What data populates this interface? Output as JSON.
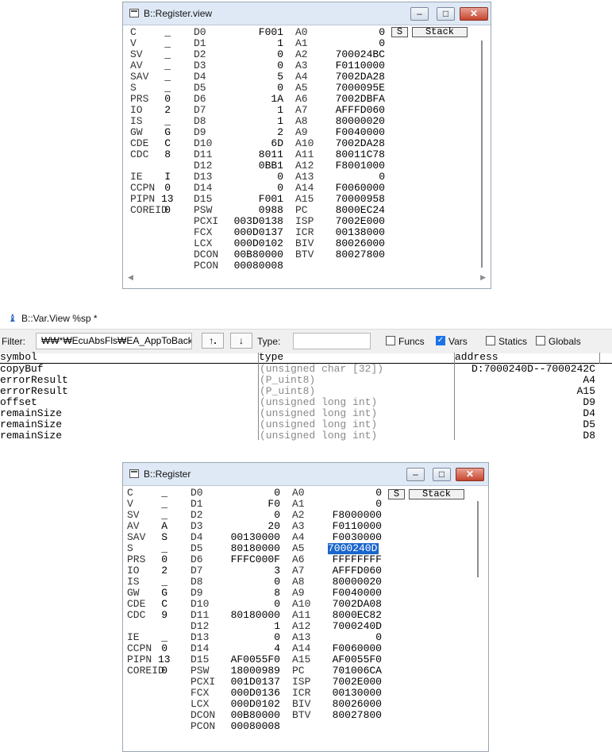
{
  "win1": {
    "title": "B::Register.view",
    "buttons": {
      "minimize": "–",
      "maximize": "□",
      "close": "✕",
      "s": "S",
      "stack": "Stack"
    },
    "flags": [
      [
        "C",
        "_"
      ],
      [
        "V",
        "_"
      ],
      [
        "SV",
        "_"
      ],
      [
        "AV",
        "_"
      ],
      [
        "SAV",
        "_"
      ],
      [
        "S",
        "_"
      ],
      [
        "PRS",
        "0"
      ],
      [
        "IO",
        "2"
      ],
      [
        "IS",
        "_"
      ],
      [
        "GW",
        "G"
      ],
      [
        "CDE",
        "C"
      ],
      [
        "CDC",
        "8"
      ],
      [
        "",
        ""
      ],
      [
        "IE",
        "I"
      ],
      [
        "CCPN",
        "0"
      ],
      [
        "PIPN",
        "13"
      ],
      [
        "COREID",
        "0"
      ]
    ],
    "d": [
      [
        "D0",
        "F001"
      ],
      [
        "D1",
        "1"
      ],
      [
        "D2",
        "0"
      ],
      [
        "D3",
        "0"
      ],
      [
        "D4",
        "5"
      ],
      [
        "D5",
        "0"
      ],
      [
        "D6",
        "1A"
      ],
      [
        "D7",
        "1"
      ],
      [
        "D8",
        "1"
      ],
      [
        "D9",
        "2"
      ],
      [
        "D10",
        "6D"
      ],
      [
        "D11",
        "8011"
      ],
      [
        "D12",
        "0BB1"
      ],
      [
        "D13",
        "0"
      ],
      [
        "D14",
        "0"
      ],
      [
        "D15",
        "F001"
      ],
      [
        "PSW",
        "0988"
      ],
      [
        "PCXI",
        "003D0138"
      ],
      [
        "FCX",
        "000D0137"
      ],
      [
        "LCX",
        "000D0102"
      ],
      [
        "DCON",
        "00B80000"
      ],
      [
        "PCON",
        "00080008"
      ]
    ],
    "a": [
      [
        "A0",
        "0"
      ],
      [
        "A1",
        "0"
      ],
      [
        "A2",
        "700024BC"
      ],
      [
        "A3",
        "F0110000"
      ],
      [
        "A4",
        "7002DA28"
      ],
      [
        "A5",
        "7000095E"
      ],
      [
        "A6",
        "7002DBFA"
      ],
      [
        "A7",
        "AFFFD060"
      ],
      [
        "A8",
        "80000020"
      ],
      [
        "A9",
        "F0040000"
      ],
      [
        "A10",
        "7002DA28"
      ],
      [
        "A11",
        "80011C78"
      ],
      [
        "A12",
        "F8001000"
      ],
      [
        "A13",
        "0"
      ],
      [
        "A14",
        "F0060000"
      ],
      [
        "A15",
        "70000958"
      ],
      [
        "PC",
        "8000EC24"
      ],
      [
        "ISP",
        "7002E000"
      ],
      [
        "ICR",
        "00138000"
      ],
      [
        "BIV",
        "80026000"
      ],
      [
        "BTV",
        "80027800"
      ]
    ]
  },
  "varview": {
    "title": "B::Var.View %sp *",
    "filter_label": "Filter:",
    "filter_value": "₩₩*₩EcuAbsFls₩EA_AppToBackup",
    "up_button": "↑.",
    "down_button": "↓",
    "type_label": "Type:",
    "type_value": "",
    "checks": [
      {
        "label": "Funcs",
        "checked": false
      },
      {
        "label": "Vars",
        "checked": true
      },
      {
        "label": "Statics",
        "checked": false
      },
      {
        "label": "Globals",
        "checked": false
      }
    ],
    "columns": [
      "symbol",
      "type",
      "address"
    ],
    "rows": [
      [
        "copyBuf",
        "(unsigned char [32])",
        "D:7000240D--7000242C"
      ],
      [
        "errorResult",
        "(P_uint8)",
        "A4"
      ],
      [
        "errorResult",
        "(P_uint8)",
        "A15"
      ],
      [
        "offset",
        "(unsigned long int)",
        "D9"
      ],
      [
        "remainSize",
        "(unsigned long int)",
        "D4"
      ],
      [
        "remainSize",
        "(unsigned long int)",
        "D5"
      ],
      [
        "remainSize",
        "(unsigned long int)",
        "D8"
      ]
    ]
  },
  "win2": {
    "title": "B::Register",
    "buttons": {
      "minimize": "–",
      "maximize": "□",
      "close": "✕",
      "s": "S",
      "stack": "Stack"
    },
    "flags": [
      [
        "C",
        "_"
      ],
      [
        "V",
        "_"
      ],
      [
        "SV",
        "_"
      ],
      [
        "AV",
        "A"
      ],
      [
        "SAV",
        "S"
      ],
      [
        "S",
        "_"
      ],
      [
        "PRS",
        "0"
      ],
      [
        "IO",
        "2"
      ],
      [
        "IS",
        "_"
      ],
      [
        "GW",
        "G"
      ],
      [
        "CDE",
        "C"
      ],
      [
        "CDC",
        "9"
      ],
      [
        "",
        ""
      ],
      [
        "IE",
        "_"
      ],
      [
        "CCPN",
        "0"
      ],
      [
        "PIPN",
        "13"
      ],
      [
        "COREID",
        "0"
      ]
    ],
    "d": [
      [
        "D0",
        "0"
      ],
      [
        "D1",
        "F0"
      ],
      [
        "D2",
        "0"
      ],
      [
        "D3",
        "20"
      ],
      [
        "D4",
        "00130000"
      ],
      [
        "D5",
        "80180000"
      ],
      [
        "D6",
        "FFFC000F"
      ],
      [
        "D7",
        "3"
      ],
      [
        "D8",
        "0"
      ],
      [
        "D9",
        "8"
      ],
      [
        "D10",
        "0"
      ],
      [
        "D11",
        "80180000"
      ],
      [
        "D12",
        "1"
      ],
      [
        "D13",
        "0"
      ],
      [
        "D14",
        "4"
      ],
      [
        "D15",
        "AF0055F0"
      ],
      [
        "PSW",
        "18000989"
      ],
      [
        "PCXI",
        "001D0137"
      ],
      [
        "FCX",
        "000D0136"
      ],
      [
        "LCX",
        "000D0102"
      ],
      [
        "DCON",
        "00B80000"
      ],
      [
        "PCON",
        "00080008"
      ]
    ],
    "a": [
      [
        "A0",
        "0"
      ],
      [
        "A1",
        "0"
      ],
      [
        "A2",
        "F8000000"
      ],
      [
        "A3",
        "F0110000"
      ],
      [
        "A4",
        "F0030000"
      ],
      [
        "A5",
        "7000240D"
      ],
      [
        "A6",
        "FFFFFFFF"
      ],
      [
        "A7",
        "AFFFD060"
      ],
      [
        "A8",
        "80000020"
      ],
      [
        "A9",
        "F0040000"
      ],
      [
        "A10",
        "7002DA08"
      ],
      [
        "A11",
        "8000EC82"
      ],
      [
        "A12",
        "7000240D"
      ],
      [
        "A13",
        "0"
      ],
      [
        "A14",
        "F0060000"
      ],
      [
        "A15",
        "AF0055F0"
      ],
      [
        "PC",
        "701006CA"
      ],
      [
        "ISP",
        "7002E000"
      ],
      [
        "ICR",
        "00130000"
      ],
      [
        "BIV",
        "80026000"
      ],
      [
        "BTV",
        "80027800"
      ]
    ],
    "selected_a": "A5"
  }
}
